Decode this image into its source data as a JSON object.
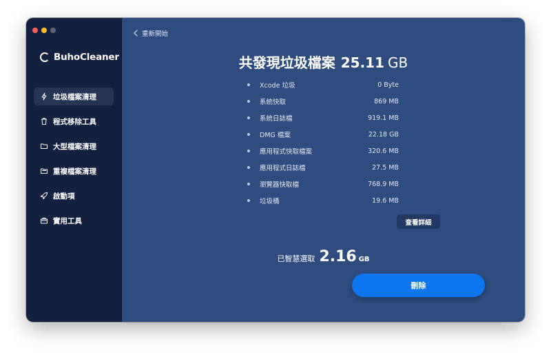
{
  "app": {
    "name": "BuhoCleaner"
  },
  "sidebar": {
    "items": [
      {
        "label": "垃圾檔案清理",
        "icon": "lightning-icon",
        "active": true
      },
      {
        "label": "程式移除工具",
        "icon": "trash-icon",
        "active": false
      },
      {
        "label": "大型檔案清理",
        "icon": "folder-icon",
        "active": false
      },
      {
        "label": "重複檔案清理",
        "icon": "folder-duplicate-icon",
        "active": false
      },
      {
        "label": "啟動項",
        "icon": "rocket-icon",
        "active": false
      },
      {
        "label": "實用工具",
        "icon": "toolbox-icon",
        "active": false
      }
    ]
  },
  "header": {
    "back_label": "重新開始"
  },
  "summary": {
    "title": "共發現垃圾檔案",
    "total_value": "25.11",
    "total_unit": "GB"
  },
  "junk_items": [
    {
      "label": "Xcode 垃圾",
      "size": "0 Byte"
    },
    {
      "label": "系統快取",
      "size": "869 MB"
    },
    {
      "label": "系統日誌檔",
      "size": "919.1 MB"
    },
    {
      "label": "DMG 檔案",
      "size": "22.18 GB"
    },
    {
      "label": "應用程式快取檔案",
      "size": "320.6 MB"
    },
    {
      "label": "應用程式日誌檔",
      "size": "27.5 MB"
    },
    {
      "label": "瀏覽器快取檔",
      "size": "768.9 MB"
    },
    {
      "label": "垃圾桶",
      "size": "19.6 MB"
    }
  ],
  "details_button": "查看詳細",
  "selected": {
    "label": "已智慧選取",
    "value": "2.16",
    "unit": "GB"
  },
  "delete_button": "刪除",
  "colors": {
    "sidebar_bg": "#142040",
    "main_bg": "#2e4c7e",
    "accent": "#0f76f1",
    "active_item_bg": "#263456"
  }
}
